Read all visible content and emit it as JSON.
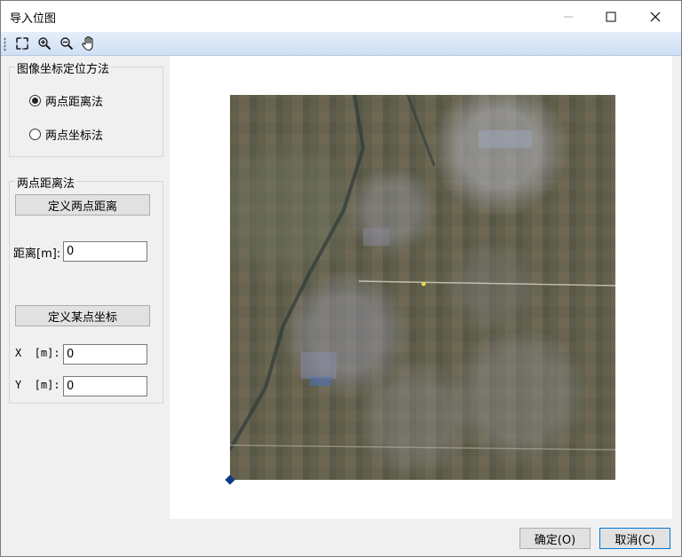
{
  "window": {
    "title": "导入位图"
  },
  "toolbar": {
    "icons": [
      "full-extent-icon",
      "zoom-in-icon",
      "zoom-out-icon",
      "pan-hand-icon"
    ]
  },
  "method_group": {
    "title": "图像坐标定位方法",
    "options": [
      {
        "label": "两点距离法",
        "selected": true
      },
      {
        "label": "两点坐标法",
        "selected": false
      }
    ]
  },
  "distance_group": {
    "title": "两点距离法",
    "define_distance_button": "定义两点距离",
    "distance_label": "距离[m]:",
    "distance_value": "0",
    "define_point_button": "定义某点坐标",
    "x_label": "X  [m]:",
    "x_value": "0",
    "y_label": "Y  [m]:",
    "y_value": "0"
  },
  "footer": {
    "ok_label": "确定(O)",
    "cancel_label": "取消(C)"
  },
  "colors": {
    "toolbar": "#dbe6f7",
    "anchor": "#0e3a8c",
    "window_bg": "#f0f0f0"
  }
}
